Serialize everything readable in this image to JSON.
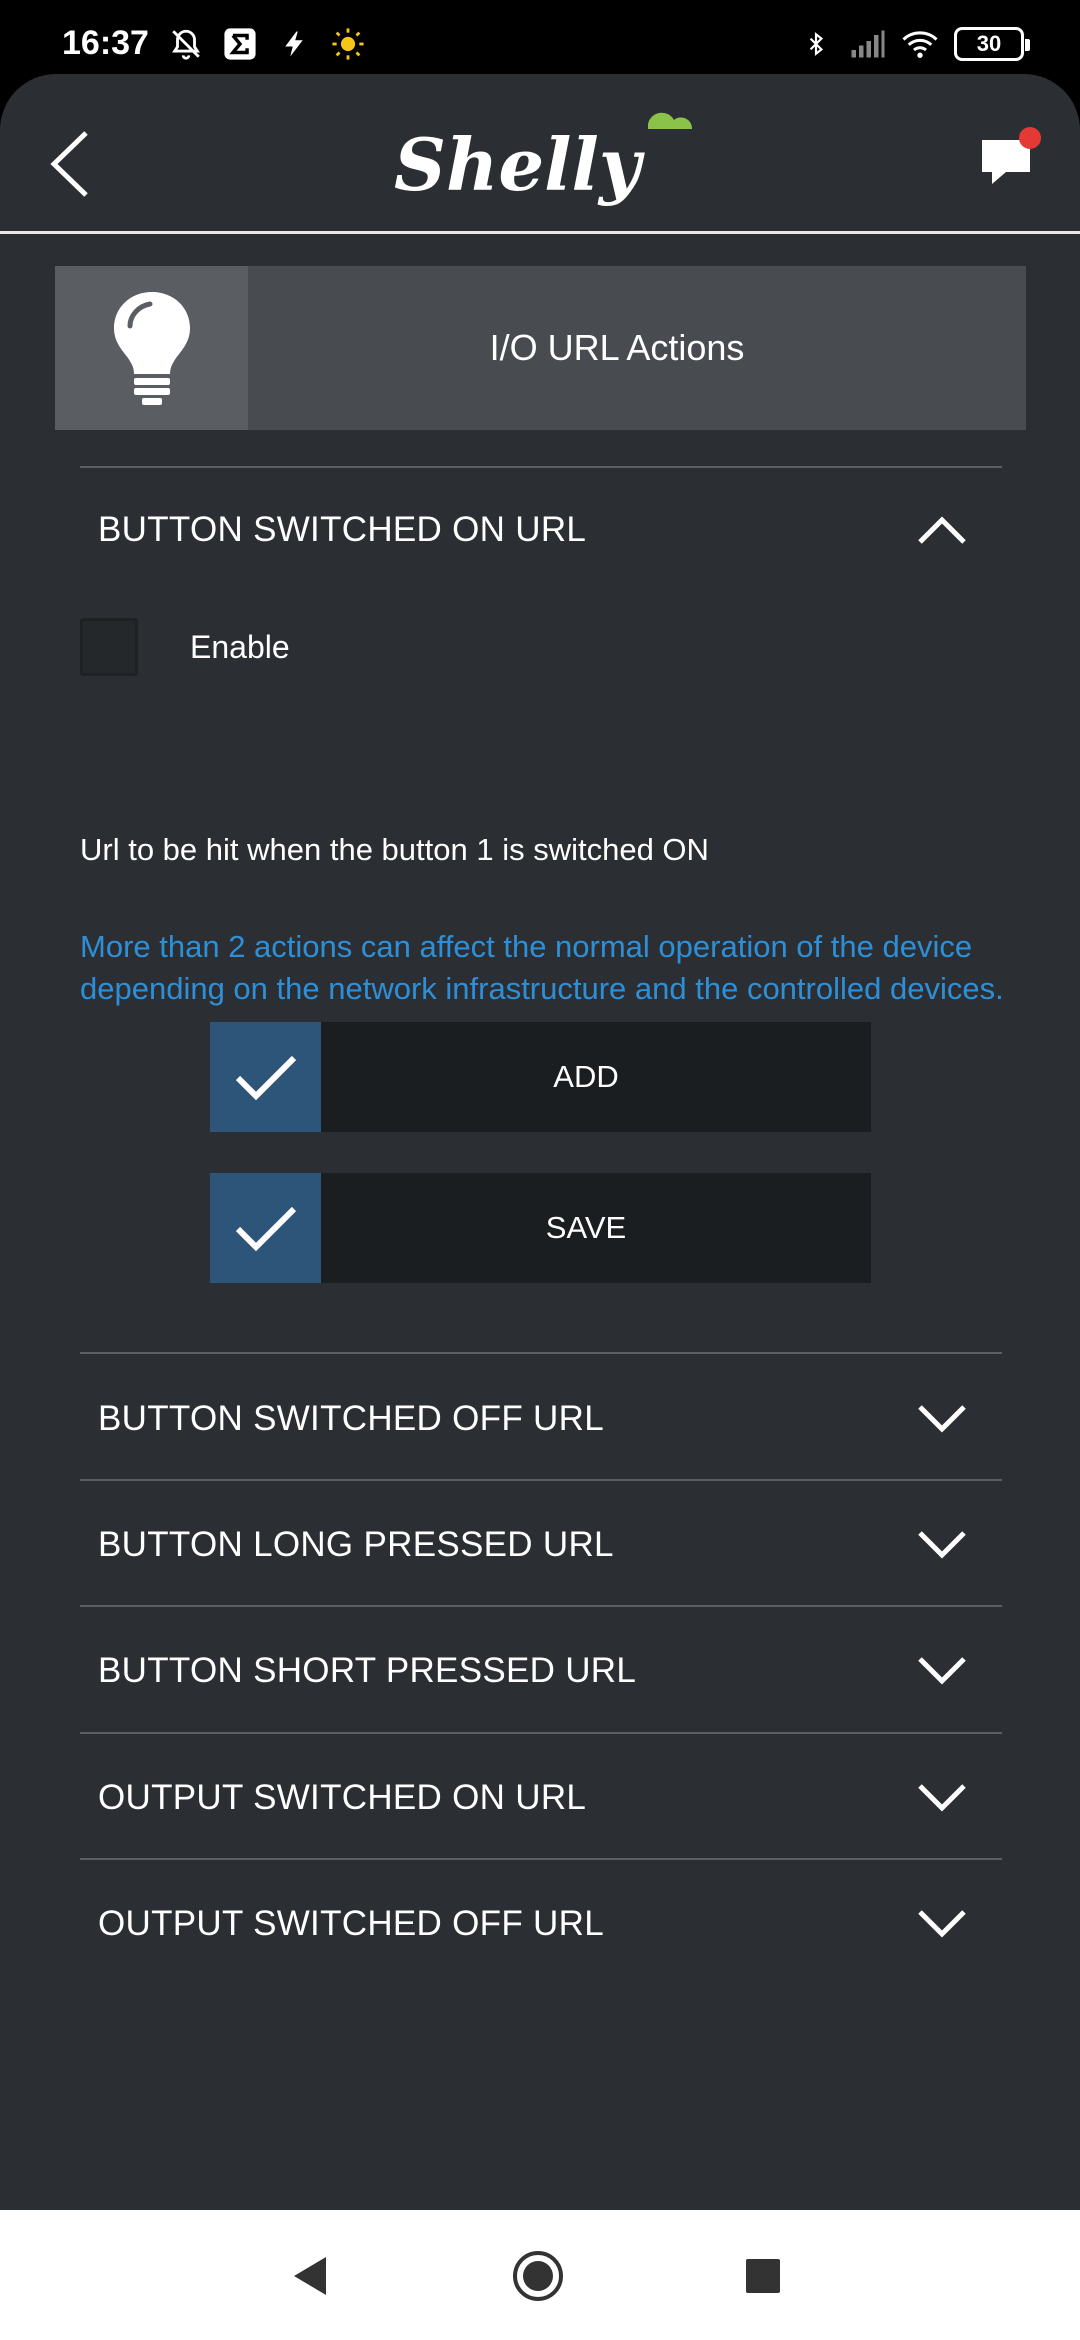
{
  "status_bar": {
    "time": "16:37",
    "battery": "30",
    "icons_left": [
      "bell-off-icon",
      "sigma-icon",
      "bolt-icon",
      "sun-icon"
    ],
    "icons_right": [
      "bluetooth-icon",
      "signal-icon",
      "wifi-icon",
      "battery-icon"
    ]
  },
  "header": {
    "logo_text": "Shelly",
    "back_icon": "chevron-left-icon",
    "chat_icon": "chat-icon",
    "accent_color": "#8bc34a",
    "notification_color": "#e53935"
  },
  "card": {
    "icon": "lightbulb-icon",
    "title": "I/O URL Actions"
  },
  "sections": {
    "expanded": {
      "label": "BUTTON SWITCHED ON URL",
      "enable_label": "Enable",
      "enabled": false,
      "description": "Url to be hit when the button 1 is switched ON",
      "warning": "More than 2 actions can affect the normal operation of the device depending on the network infrastructure and the controlled devices.",
      "add_label": "ADD",
      "save_label": "SAVE"
    },
    "collapsed": [
      {
        "label": "BUTTON SWITCHED OFF URL"
      },
      {
        "label": "BUTTON LONG PRESSED URL"
      },
      {
        "label": "BUTTON SHORT PRESSED URL"
      },
      {
        "label": "OUTPUT SWITCHED ON URL"
      },
      {
        "label": "OUTPUT SWITCHED OFF URL"
      }
    ]
  },
  "colors": {
    "background": "#2b2f33",
    "button_accent": "#2d5579",
    "warning_text": "#2f8fd6"
  }
}
